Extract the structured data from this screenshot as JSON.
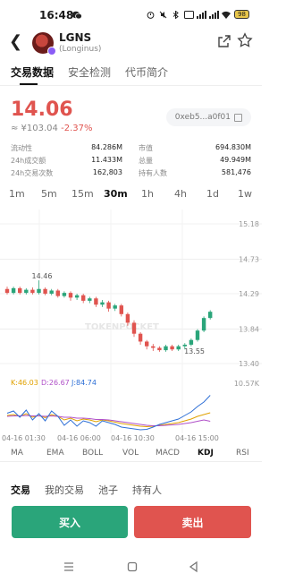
{
  "status": {
    "time": "16:48",
    "battery": "98"
  },
  "token": {
    "symbol": "LGNS",
    "name": "(Longinus)",
    "price": "14.06",
    "price_cny": "≈ ¥103.04",
    "change": "-2.37%",
    "address": "0xeb5...a0f01"
  },
  "tabs": [
    "交易数据",
    "安全检测",
    "代币简介"
  ],
  "stats": {
    "left": [
      {
        "label": "流动性",
        "value": "84.286M"
      },
      {
        "label": "24h成交额",
        "value": "11.433M"
      },
      {
        "label": "24h交易次数",
        "value": "162,803"
      }
    ],
    "right": [
      {
        "label": "市值",
        "value": "694.830M"
      },
      {
        "label": "总量",
        "value": "49.949M"
      },
      {
        "label": "持有人数",
        "value": "581,476"
      }
    ]
  },
  "intervals": [
    "1m",
    "5m",
    "15m",
    "30m",
    "1h",
    "4h",
    "1d",
    "1w"
  ],
  "selected_interval": "30m",
  "chart": {
    "y_labels": [
      "15.18",
      "14.73",
      "14.29",
      "13.84",
      "13.40"
    ],
    "high_marker": "14.46",
    "low_marker": "13.55",
    "watermark": "TOKENPOCKET",
    "kdj_max": "10.57K",
    "kdj": {
      "k": "K:46.03",
      "d": "D:26.67",
      "j": "J:84.74"
    },
    "x_labels": [
      "04-16 01:30",
      "04-16 06:00",
      "04-16 10:30",
      "04-16 15:00"
    ],
    "colors": {
      "up": "#2aa57a",
      "down": "#e0544f",
      "k": "#e0a100",
      "d": "#b050c8",
      "j": "#2e6fd6"
    }
  },
  "chart_data": {
    "type": "candlestick",
    "title": "",
    "ylim": [
      13.4,
      15.18
    ],
    "candles": [
      {
        "o": 14.35,
        "c": 14.3,
        "h": 14.38,
        "l": 14.28
      },
      {
        "o": 14.3,
        "c": 14.36,
        "h": 14.38,
        "l": 14.28
      },
      {
        "o": 14.36,
        "c": 14.3,
        "h": 14.38,
        "l": 14.28
      },
      {
        "o": 14.3,
        "c": 14.34,
        "h": 14.36,
        "l": 14.28
      },
      {
        "o": 14.34,
        "c": 14.3,
        "h": 14.37,
        "l": 14.28
      },
      {
        "o": 14.3,
        "c": 14.35,
        "h": 14.46,
        "l": 14.28
      },
      {
        "o": 14.35,
        "c": 14.29,
        "h": 14.37,
        "l": 14.27
      },
      {
        "o": 14.29,
        "c": 14.33,
        "h": 14.35,
        "l": 14.27
      },
      {
        "o": 14.33,
        "c": 14.26,
        "h": 14.35,
        "l": 14.24
      },
      {
        "o": 14.26,
        "c": 14.3,
        "h": 14.32,
        "l": 14.24
      },
      {
        "o": 14.3,
        "c": 14.24,
        "h": 14.32,
        "l": 14.2
      },
      {
        "o": 14.24,
        "c": 14.27,
        "h": 14.29,
        "l": 14.21
      },
      {
        "o": 14.27,
        "c": 14.2,
        "h": 14.29,
        "l": 14.17
      },
      {
        "o": 14.2,
        "c": 14.23,
        "h": 14.25,
        "l": 14.17
      },
      {
        "o": 14.23,
        "c": 14.15,
        "h": 14.25,
        "l": 14.12
      },
      {
        "o": 14.15,
        "c": 14.18,
        "h": 14.21,
        "l": 14.12
      },
      {
        "o": 14.18,
        "c": 14.1,
        "h": 14.2,
        "l": 14.06
      },
      {
        "o": 14.1,
        "c": 14.14,
        "h": 14.16,
        "l": 14.07
      },
      {
        "o": 14.14,
        "c": 14.03,
        "h": 14.16,
        "l": 14.0
      },
      {
        "o": 14.03,
        "c": 13.92,
        "h": 14.05,
        "l": 13.88
      },
      {
        "o": 13.92,
        "c": 13.78,
        "h": 13.95,
        "l": 13.74
      },
      {
        "o": 13.78,
        "c": 13.68,
        "h": 13.8,
        "l": 13.64
      },
      {
        "o": 13.68,
        "c": 13.62,
        "h": 13.7,
        "l": 13.58
      },
      {
        "o": 13.62,
        "c": 13.6,
        "h": 13.65,
        "l": 13.56
      },
      {
        "o": 13.6,
        "c": 13.57,
        "h": 13.62,
        "l": 13.55
      },
      {
        "o": 13.57,
        "c": 13.62,
        "h": 13.64,
        "l": 13.55
      },
      {
        "o": 13.62,
        "c": 13.58,
        "h": 13.64,
        "l": 13.56
      },
      {
        "o": 13.58,
        "c": 13.62,
        "h": 13.64,
        "l": 13.56
      },
      {
        "o": 13.62,
        "c": 13.64,
        "h": 13.66,
        "l": 13.58
      },
      {
        "o": 13.64,
        "c": 13.7,
        "h": 13.72,
        "l": 13.62
      },
      {
        "o": 13.7,
        "c": 13.82,
        "h": 13.84,
        "l": 13.68
      },
      {
        "o": 13.82,
        "c": 13.98,
        "h": 14.0,
        "l": 13.8
      },
      {
        "o": 13.98,
        "c": 14.06,
        "h": 14.08,
        "l": 13.96
      }
    ],
    "kdj_k": [
      40,
      42,
      38,
      44,
      36,
      40,
      35,
      42,
      38,
      30,
      34,
      28,
      32,
      30,
      26,
      30,
      28,
      25,
      22,
      20,
      18,
      16,
      15,
      16,
      18,
      20,
      22,
      24,
      28,
      32,
      38,
      42,
      46
    ],
    "kdj_d": [
      38,
      39,
      39,
      40,
      39,
      39,
      38,
      39,
      38,
      36,
      36,
      34,
      34,
      33,
      31,
      31,
      30,
      28,
      26,
      24,
      22,
      20,
      18,
      17,
      17,
      18,
      19,
      20,
      22,
      24,
      27,
      30,
      27
    ],
    "kdj_j": [
      45,
      50,
      36,
      52,
      30,
      44,
      28,
      50,
      38,
      18,
      30,
      16,
      28,
      24,
      16,
      28,
      24,
      20,
      14,
      12,
      10,
      8,
      9,
      14,
      20,
      24,
      28,
      32,
      40,
      48,
      60,
      70,
      85
    ]
  },
  "indicators": [
    "MA",
    "EMA",
    "BOLL",
    "VOL",
    "MACD",
    "KDJ",
    "RSI"
  ],
  "selected_indicator": "KDJ",
  "bottom_tabs": [
    "交易",
    "我的交易",
    "池子",
    "持有人"
  ],
  "actions": {
    "buy": "买入",
    "sell": "卖出"
  }
}
